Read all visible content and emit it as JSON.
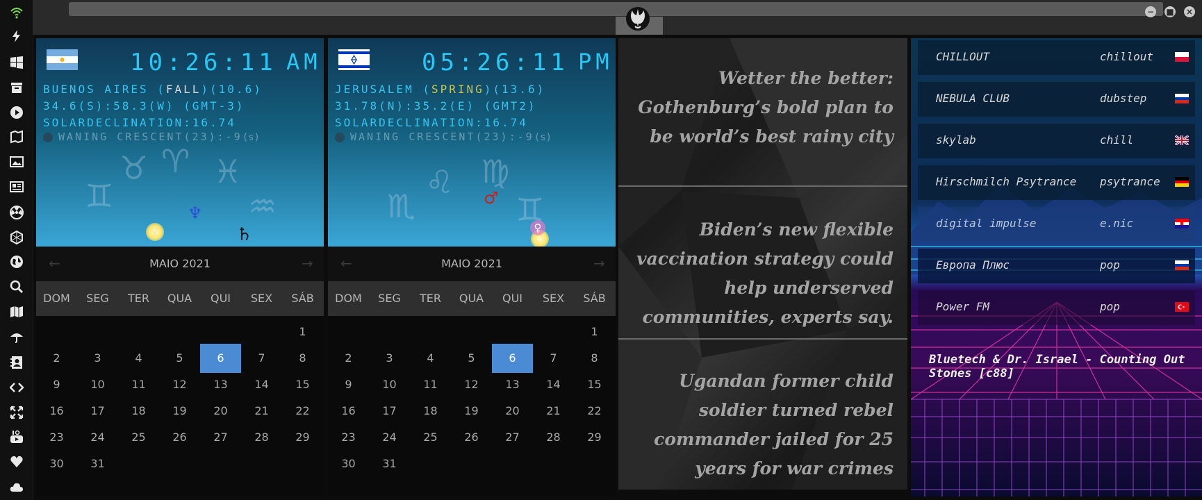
{
  "sidebar": {
    "icons": [
      "wifi-icon",
      "lightning-icon",
      "windows-icon",
      "archive-icon",
      "play-icon",
      "map-book-icon",
      "image-icon",
      "news-icon",
      "radiation-icon",
      "hexagon-icon",
      "globe-icon",
      "search-icon",
      "map-icon",
      "umbrella-icon",
      "contact-icon",
      "code-icon",
      "expand-icon",
      "youtube-icon",
      "heart-icon",
      "cloud-icon"
    ]
  },
  "window": {
    "minimize": "−",
    "maximize": "■",
    "close": "×"
  },
  "clocks": [
    {
      "flag": "argentina",
      "time": "10:26:11",
      "ampm": "AM",
      "city": "BUENOS AIRES",
      "season": "FALL",
      "season_open": "(",
      "season_rest": ")(10.6)",
      "coords": "34.6(S):58.3(W) (GMT-3)",
      "declination": "SOLARDECLINATION:16.74",
      "moon_phase": "WANING CRESCENT(23):-9",
      "moon_unit": "(s)"
    },
    {
      "flag": "israel",
      "time": "05:26:11",
      "ampm": "PM",
      "city": "JERUSALEM",
      "season": "SPRING",
      "season_open": "(",
      "season_rest": ")(13.6)",
      "coords": "31.78(N):35.2(E) (GMT2)",
      "declination": "SOLARDECLINATION:16.74",
      "moon_phase": "WANING CRESCENT(23):-9",
      "moon_unit": "(s)"
    }
  ],
  "calendars": [
    {
      "month": "MAIO 2021",
      "prev": "←",
      "next": "→",
      "weekdays": [
        "DOM",
        "SEG",
        "TER",
        "QUA",
        "QUI",
        "SEX",
        "SÁB"
      ],
      "first_weekday": 6,
      "days": 31,
      "selected": 6
    },
    {
      "month": "MAIO 2021",
      "prev": "←",
      "next": "→",
      "weekdays": [
        "DOM",
        "SEG",
        "TER",
        "QUA",
        "QUI",
        "SEX",
        "SÁB"
      ],
      "first_weekday": 6,
      "days": 31,
      "selected": 6
    }
  ],
  "news": [
    {
      "headline": "Wetter the better: Gothenburg’s bold plan to be world’s best rainy city"
    },
    {
      "headline": "Biden’s new flexible vaccination strategy could help underserved communities, experts say."
    },
    {
      "headline": "Ugandan former child soldier turned rebel commander jailed for 25 years for war crimes"
    }
  ],
  "radio": {
    "stations": [
      {
        "name": "CHILLOUT",
        "genre": "chillout",
        "flag": "poland"
      },
      {
        "name": "NEBULA CLUB",
        "genre": "dubstep",
        "flag": "russia"
      },
      {
        "name": "skylab",
        "genre": "chill",
        "flag": "uk"
      },
      {
        "name": "Hirschmilch Psytrance",
        "genre": "psytrance",
        "flag": "germany"
      },
      {
        "name": "digital impulse",
        "genre": "e.nic",
        "flag": "croatia"
      },
      {
        "name": "Европа Плюс",
        "genre": "pop",
        "flag": "russia"
      },
      {
        "name": "Power FM",
        "genre": "pop",
        "flag": "turkey"
      }
    ],
    "now_playing": "Bluetech & Dr. Israel - Counting Out Stones [c88]"
  }
}
